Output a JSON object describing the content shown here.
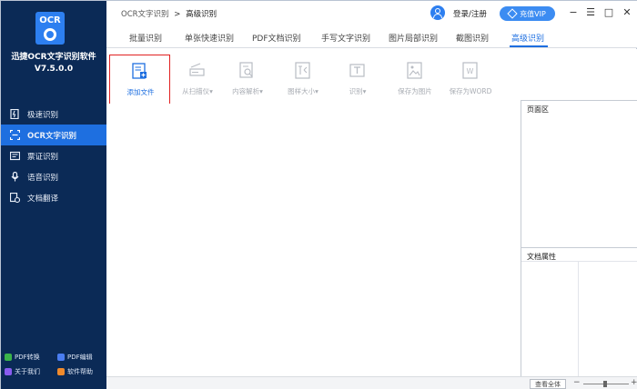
{
  "app": {
    "logo_text": "OCR",
    "name": "迅捷OCR文字识别软件",
    "version": "V7.5.0.0"
  },
  "sidebar": {
    "items": [
      {
        "label": "极速识别",
        "icon": "lightning-doc-icon"
      },
      {
        "label": "OCR文字识别",
        "icon": "scan-icon"
      },
      {
        "label": "票证识别",
        "icon": "ticket-icon"
      },
      {
        "label": "语音识别",
        "icon": "microphone-icon"
      },
      {
        "label": "文档翻译",
        "icon": "translate-icon"
      }
    ],
    "active_index": 1,
    "bottom_links": [
      {
        "label": "PDF转换",
        "color": "#3bb34a"
      },
      {
        "label": "PDF编辑",
        "color": "#4a7df0"
      },
      {
        "label": "关于我们",
        "color": "#8a5cf0"
      },
      {
        "label": "软件帮助",
        "color": "#f08a2c"
      }
    ]
  },
  "header": {
    "breadcrumb_root": "OCR文字识别",
    "breadcrumb_sep": ">",
    "breadcrumb_current": "高级识别",
    "login_label": "登录/注册",
    "vip_label": "充值VIP",
    "minimize": "−",
    "menu": "☰",
    "maximize": "□",
    "close": "✕"
  },
  "tabs": [
    {
      "label": "批量识别"
    },
    {
      "label": "单张快速识别"
    },
    {
      "label": "PDF文档识别"
    },
    {
      "label": "手写文字识别"
    },
    {
      "label": "图片局部识别"
    },
    {
      "label": "截图识别"
    },
    {
      "label": "高级识别"
    }
  ],
  "active_tab": 6,
  "toolbar": [
    {
      "label": "添加文件",
      "enabled": true
    },
    {
      "label": "从扫描仪▾",
      "enabled": false
    },
    {
      "label": "内容解析▾",
      "enabled": false
    },
    {
      "label": "图样大小▾",
      "enabled": false
    },
    {
      "label": "识别▾",
      "enabled": false
    },
    {
      "label": "保存为图片",
      "enabled": false
    },
    {
      "label": "保存为WORD",
      "enabled": false
    }
  ],
  "right_panel": {
    "page_area_title": "页面区",
    "doc_props_title": "文档属性"
  },
  "statusbar": {
    "fit_label": "查看全体",
    "zoom_minus": "−",
    "zoom_plus": "+"
  },
  "colors": {
    "sidebar_bg": "#0b2a56",
    "accent": "#1e6fe0",
    "highlight_border": "#e02020"
  }
}
